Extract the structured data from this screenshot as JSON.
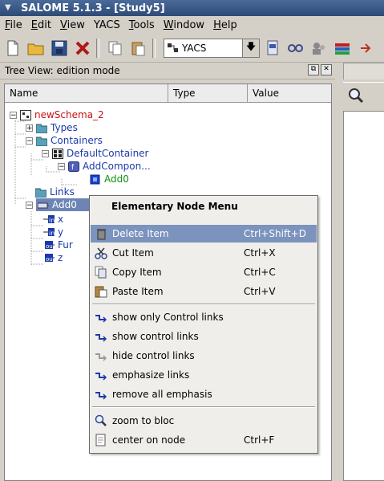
{
  "window": {
    "title": "SALOME 5.1.3 - [Study5]"
  },
  "menubar": [
    {
      "u": "F",
      "rest": "ile"
    },
    {
      "u": "E",
      "rest": "dit"
    },
    {
      "u": "V",
      "rest": "iew"
    },
    {
      "u": "",
      "rest": "YACS"
    },
    {
      "u": "T",
      "rest": "ools"
    },
    {
      "u": "W",
      "rest": "indow"
    },
    {
      "u": "H",
      "rest": "elp"
    }
  ],
  "toolbar": {
    "module_selector": "YACS"
  },
  "tree_panel": {
    "title": "Tree View: edition mode",
    "columns": [
      "Name",
      "Type",
      "Value"
    ],
    "nodes": {
      "schema": "newSchema_2",
      "types": "Types",
      "containers": "Containers",
      "default_container": "DefaultContainer",
      "add_component": "AddCompon...",
      "add0_ref": "Add0",
      "links": "Links",
      "add0": "Add0",
      "port_x": "x",
      "port_y": "y",
      "port_func": "Fur",
      "port_z": "z"
    }
  },
  "context_menu": {
    "title": "Elementary Node Menu",
    "items": [
      {
        "label": "Delete Item",
        "shortcut": "Ctrl+Shift+D",
        "icon": "trash-icon"
      },
      {
        "label": "Cut Item",
        "shortcut": "Ctrl+X",
        "icon": "scissors-icon"
      },
      {
        "label": "Copy Item",
        "shortcut": "Ctrl+C",
        "icon": "copy-icon"
      },
      {
        "label": "Paste Item",
        "shortcut": "Ctrl+V",
        "icon": "paste-icon"
      },
      {
        "label": "show only Control links",
        "shortcut": "",
        "icon": "control-link-icon"
      },
      {
        "label": "show control links",
        "shortcut": "",
        "icon": "control-link-icon"
      },
      {
        "label": "hide control links",
        "shortcut": "",
        "icon": "control-link-grey-icon"
      },
      {
        "label": "emphasize links",
        "shortcut": "",
        "icon": "control-link-icon"
      },
      {
        "label": "remove all emphasis",
        "shortcut": "",
        "icon": "control-link-icon"
      },
      {
        "label": "zoom to bloc",
        "shortcut": "",
        "icon": "magnifier-icon"
      },
      {
        "label": "center on node",
        "shortcut": "Ctrl+F",
        "icon": "page-icon"
      }
    ]
  },
  "colors": {
    "selection": "#7b93bd",
    "node_red": "#cc1010",
    "node_blue": "#1a3aa8",
    "node_green": "#109010"
  }
}
